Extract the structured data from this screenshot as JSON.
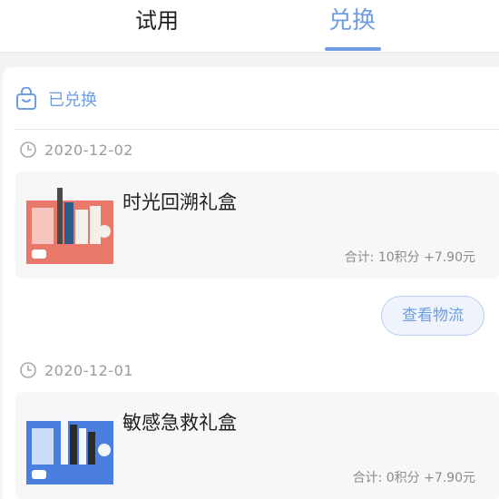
{
  "tabs": [
    {
      "label": "试用",
      "active": false
    },
    {
      "label": "兑换",
      "active": true
    }
  ],
  "accent_color": "#6f9de4",
  "section": {
    "label": "已兑换",
    "icon": "shopping-bag-icon"
  },
  "orders": [
    {
      "date": "2020-12-02",
      "title": "时光回溯礼盒",
      "total": "合计: 10积分 +7.90元",
      "thumb_color": "#e9776a",
      "action_label": "查看物流"
    },
    {
      "date": "2020-12-01",
      "title": "敏感急救礼盒",
      "total": "合计: 0积分 +7.90元",
      "thumb_color": "#4a7fe0"
    }
  ]
}
